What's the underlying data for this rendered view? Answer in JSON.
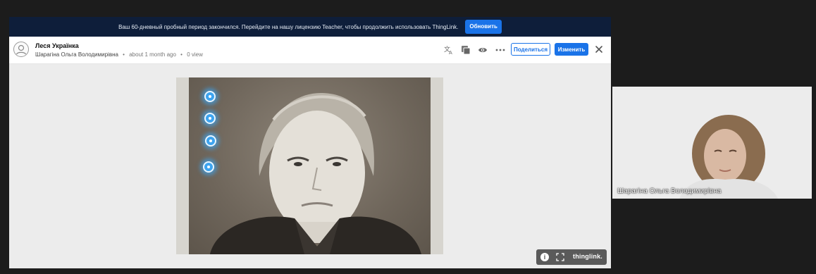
{
  "banner": {
    "message": "Ваш 60-дневный пробный период закончился. Перейдите на нашу лицензию Teacher, чтобы продолжить использовать ThingLink.",
    "update_label": "Обновить"
  },
  "header": {
    "title": "Леся Українка",
    "author": "Шарагіна Ольга Володимирівна",
    "time": "about 1 month ago",
    "views": "0 view",
    "share_label": "Поделиться",
    "edit_label": "Изменить"
  },
  "icons": [
    "avatar-icon",
    "translate-icon",
    "slides-icon",
    "eye-icon",
    "more-icon",
    "close-icon",
    "info-icon",
    "fullscreen-icon"
  ],
  "thinglink_logo": "thinglink.",
  "hotspot_count": 4,
  "colors": {
    "accent": "#1a73e8",
    "banner_bg": "#0e1e3a",
    "hotspot": "#3da4f0"
  },
  "webcam": {
    "name": "Шарагіна Ольга Володимирівна"
  }
}
